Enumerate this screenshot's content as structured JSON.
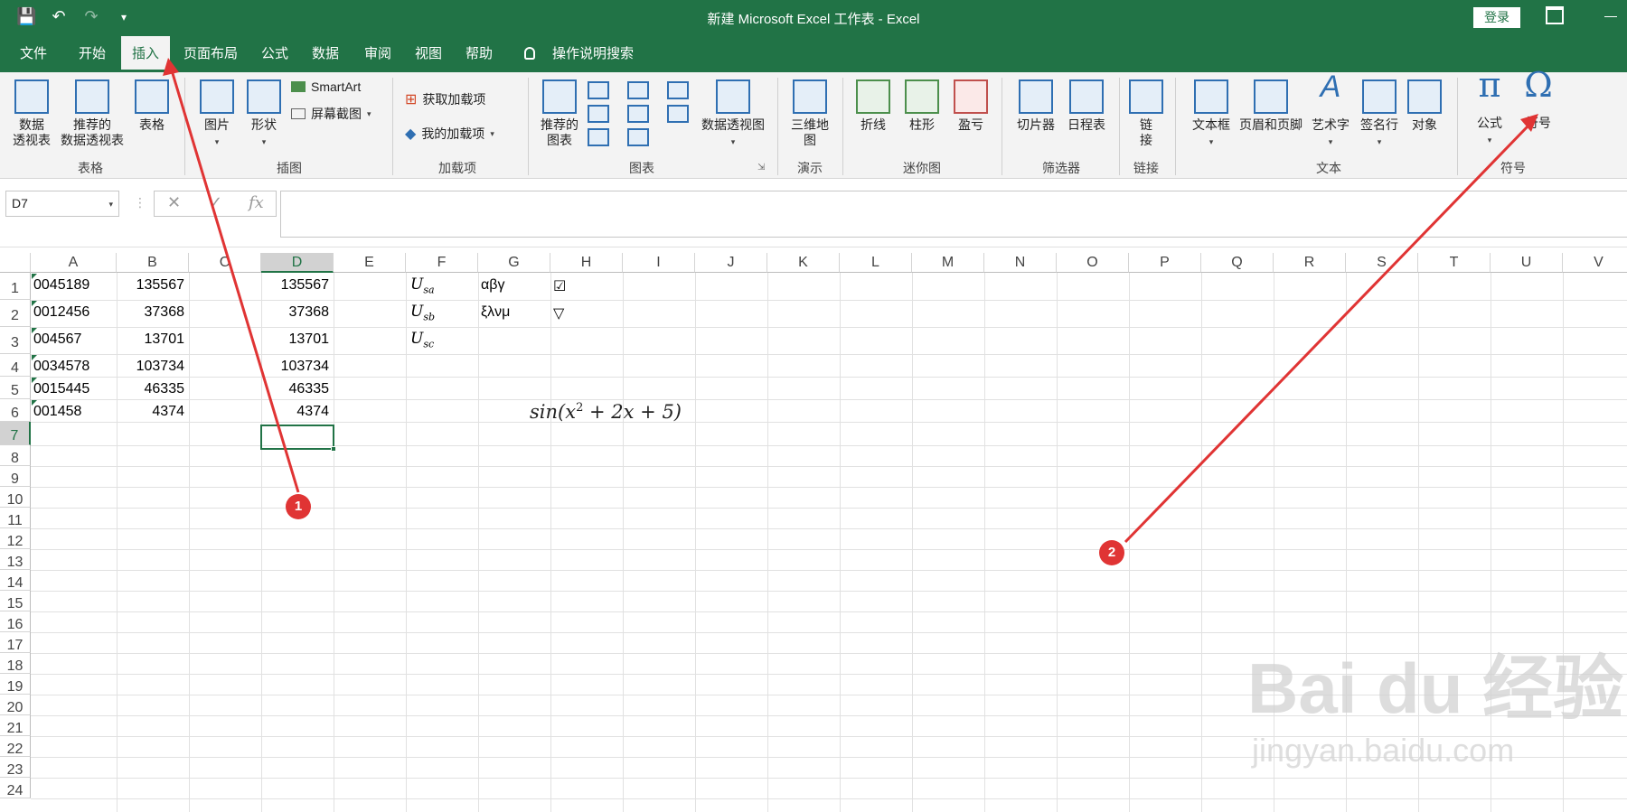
{
  "title": "新建 Microsoft Excel 工作表 - Excel",
  "login": "登录",
  "tabs": [
    "文件",
    "开始",
    "插入",
    "页面布局",
    "公式",
    "数据",
    "审阅",
    "视图",
    "帮助"
  ],
  "search_label": "操作说明搜索",
  "ribbon": {
    "pivot": "数据\n透视表",
    "rec_pivot": "推荐的\n数据透视表",
    "table": "表格",
    "group_table": "表格",
    "picture": "图片",
    "shapes": "形状",
    "smartart": "SmartArt",
    "screenshot": "屏幕截图",
    "group_illus": "插图",
    "get_addins": "获取加载项",
    "my_addins": "我的加载项",
    "group_addins": "加载项",
    "rec_charts": "推荐的\n图表",
    "pivot_chart": "数据透视图",
    "group_charts": "图表",
    "map3d": "三维地\n图",
    "group_tour": "演示",
    "line": "折线",
    "column": "柱形",
    "winloss": "盈亏",
    "group_spark": "迷你图",
    "slicer": "切片器",
    "timeline": "日程表",
    "group_filter": "筛选器",
    "link": "链\n接",
    "group_links": "链接",
    "textbox": "文本框",
    "header_footer": "页眉和页脚",
    "wordart": "艺术字",
    "sigline": "签名行",
    "object": "对象",
    "group_text": "文本",
    "equation": "公式",
    "symbol": "符号",
    "group_symbols": "符号"
  },
  "namebox": "D7",
  "columns": [
    "A",
    "B",
    "C",
    "D",
    "E",
    "F",
    "G",
    "H",
    "I",
    "J",
    "K",
    "L",
    "M",
    "N",
    "O",
    "P",
    "Q",
    "R",
    "S",
    "T",
    "U",
    "V"
  ],
  "selected_column": "D",
  "selected_row": 7,
  "rows": [
    1,
    2,
    3,
    4,
    5,
    6,
    7,
    8,
    9,
    10,
    11,
    12,
    13,
    14,
    15,
    16,
    17,
    18,
    19,
    20,
    21,
    22,
    23,
    24
  ],
  "cells": {
    "A": [
      "0045189",
      "0012456",
      "004567",
      "0034578",
      "0015445",
      "001458"
    ],
    "B": [
      "135567",
      "37368",
      "13701",
      "103734",
      "46335",
      "4374"
    ],
    "D": [
      "135567",
      "37368",
      "13701",
      "103734",
      "46335",
      "4374"
    ],
    "F": [
      {
        "base": "U",
        "sub": "sa"
      },
      {
        "base": "U",
        "sub": "sb"
      },
      {
        "base": "U",
        "sub": "sc"
      }
    ],
    "G": [
      "αβγ",
      "ξλνμ"
    ],
    "H": [
      "☑",
      "▽"
    ]
  },
  "equation": {
    "pre": "sin(x",
    "sup": "2",
    "post": " + 2x + 5)"
  },
  "watermark": {
    "logo": "Bai du 经验",
    "url": "jingyan.baidu.com"
  },
  "badges": [
    "1",
    "2"
  ],
  "colors": {
    "accent": "#217346",
    "arrow": "#e03434"
  }
}
